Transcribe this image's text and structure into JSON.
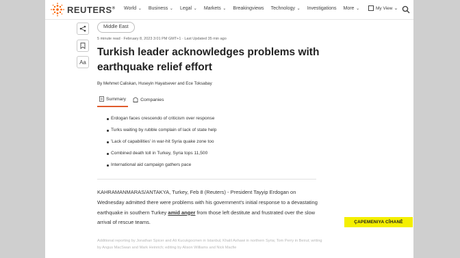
{
  "header": {
    "logo_text": "REUTERS",
    "nav_items": [
      {
        "label": "World",
        "has_dropdown": true
      },
      {
        "label": "Business",
        "has_dropdown": true
      },
      {
        "label": "Legal",
        "has_dropdown": true
      },
      {
        "label": "Markets",
        "has_dropdown": true
      },
      {
        "label": "Breakingviews",
        "has_dropdown": false
      },
      {
        "label": "Technology",
        "has_dropdown": true
      },
      {
        "label": "Investigations",
        "has_dropdown": false
      },
      {
        "label": "More",
        "has_dropdown": true
      }
    ],
    "my_view_label": "My View",
    "accent_color": "#fa6400"
  },
  "side_tools": {
    "share_icon": "share-icon",
    "bookmark_icon": "bookmark-icon",
    "text_size_label": "Aa"
  },
  "article": {
    "tag": "Middle East",
    "meta": "5 minute read · February 8, 2023 3:01 PM GMT+1 · Last Updated 35 min ago",
    "title": "Turkish leader acknowledges problems with earthquake relief effort",
    "byline": "By Mehmet Caliskan, Huseyin Hayatsever and Ece Toksabay",
    "tabs": [
      {
        "label": "Summary",
        "icon": "document-icon",
        "active": true
      },
      {
        "label": "Companies",
        "icon": "building-icon",
        "active": false
      }
    ],
    "summary_points": [
      "Erdogan faces crescendo of criticism over response",
      "Turks waiting by rubble complain of lack of state help",
      "'Lack of capabilities' in war-hit Syria quake zone too",
      "Combined death toll in Turkey, Syria tops 11,500",
      "International aid campaign gathers pace"
    ],
    "body_part1": "KAHRAMANMARAS/ANTAKYA, Turkey, Feb 8 (Reuters) - President Tayyip Erdogan on Wednesday admitted there were problems with his government's initial response to a devastating earthquake in southern Turkey ",
    "body_link": "amid anger",
    "body_part2": " from those left destitute and frustrated over the slow arrival of rescue teams.",
    "credits": "Additional reporting by Jonathan Spicer and Ali Kucukgocmen in Istanbul, Khalil Ashawi in northern Syria; Tom Perry in Beirut; writing by Angus MacSwan and Mark Heinrich; editing by Alison Williams and Nick Macfie"
  },
  "watermark": {
    "text": "ÇAPEMENIYA CÎHANÊ",
    "bg_color": "#f4ef00"
  }
}
